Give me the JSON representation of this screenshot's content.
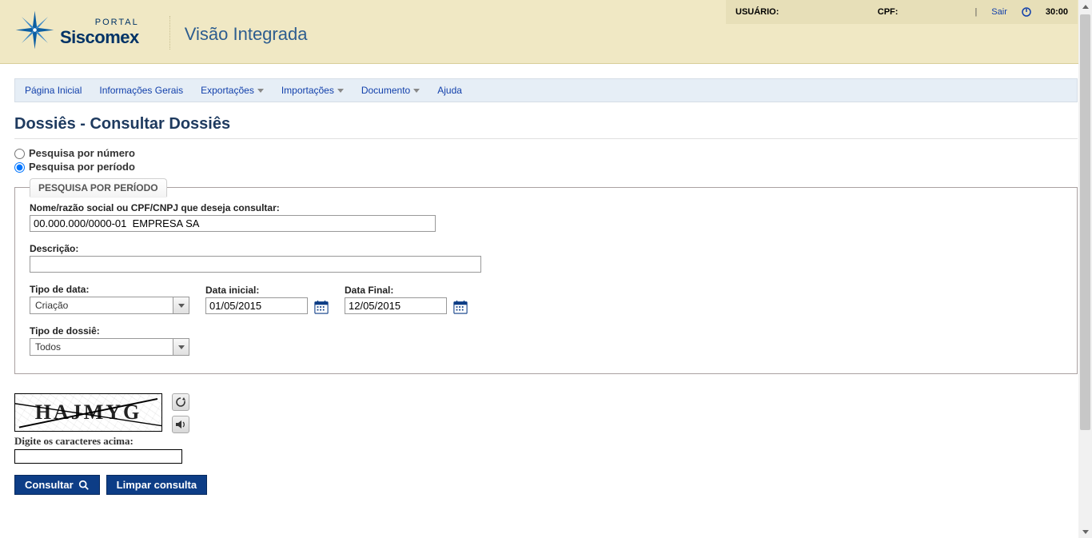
{
  "header": {
    "portal_label": "PORTAL",
    "brand": "Siscomex",
    "app_title": "Visão Integrada",
    "user_label": "USUÁRIO:",
    "cpf_label": "CPF:",
    "sair_label": "Sair",
    "session_timer": "30:00"
  },
  "nav": {
    "items": [
      {
        "label": "Página Inicial",
        "has_dropdown": false
      },
      {
        "label": "Informações Gerais",
        "has_dropdown": false
      },
      {
        "label": "Exportações",
        "has_dropdown": true
      },
      {
        "label": "Importações",
        "has_dropdown": true
      },
      {
        "label": "Documento",
        "has_dropdown": true
      },
      {
        "label": "Ajuda",
        "has_dropdown": false
      }
    ]
  },
  "page": {
    "title": "Dossiês - Consultar Dossiês"
  },
  "search_mode": {
    "by_number_label": "Pesquisa por número",
    "by_period_label": "Pesquisa por período",
    "selected": "periodo"
  },
  "fieldset": {
    "legend": "PESQUISA POR PERÍODO",
    "name_label": "Nome/razão social ou CPF/CNPJ que deseja consultar:",
    "name_value": "00.000.000/0000-01  EMPRESA SA",
    "desc_label": "Descrição:",
    "desc_value": "",
    "tipo_data_label": "Tipo de data:",
    "tipo_data_value": "Criação",
    "data_inicial_label": "Data inicial:",
    "data_inicial_value": "01/05/2015",
    "data_final_label": "Data Final:",
    "data_final_value": "12/05/2015",
    "tipo_dossie_label": "Tipo de dossiê:",
    "tipo_dossie_value": "Todos"
  },
  "captcha": {
    "image_text": "HAJMYG",
    "input_label": "Digite os caracteres acima:",
    "input_value": ""
  },
  "actions": {
    "consult_label": "Consultar",
    "clear_label": "Limpar consulta"
  }
}
